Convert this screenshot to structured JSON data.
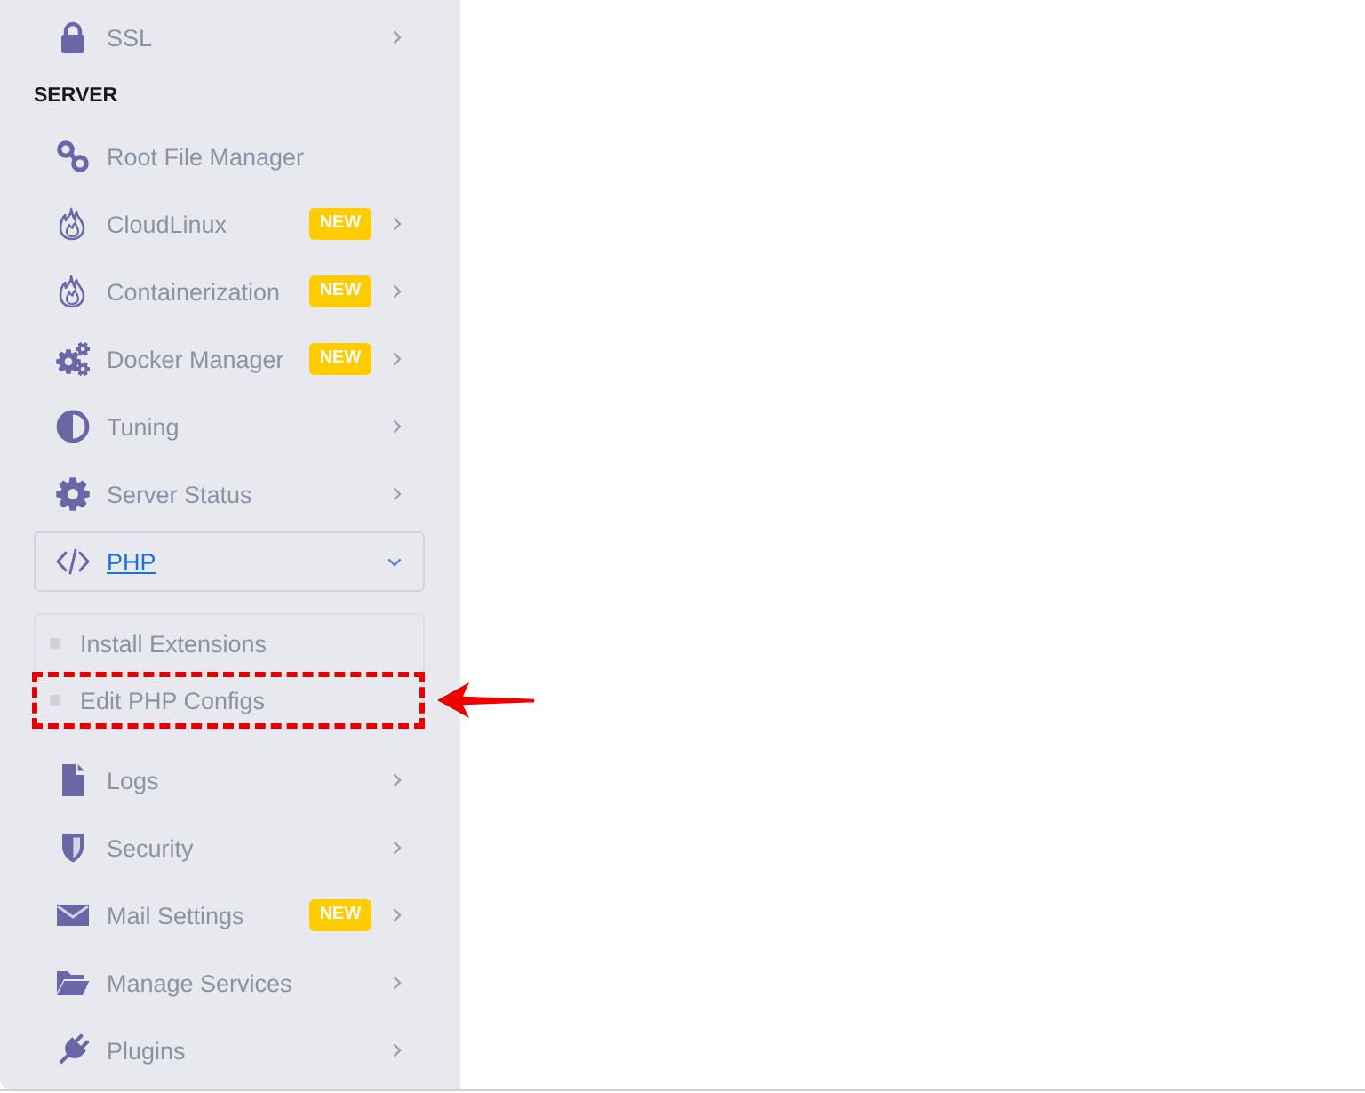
{
  "sidebar": {
    "items": [
      {
        "kind": "menu",
        "label": "SSL",
        "selected": false,
        "expanded": false
      },
      {
        "kind": "header",
        "label": "SERVER"
      },
      {
        "kind": "link",
        "label": "Root File Manager",
        "selected": false
      },
      {
        "kind": "menu",
        "label": "CloudLinux",
        "badge": "NEW",
        "selected": false,
        "expanded": false
      },
      {
        "kind": "menu",
        "label": "Containerization",
        "badge": "NEW",
        "selected": false,
        "expanded": false
      },
      {
        "kind": "menu",
        "label": "Docker Manager",
        "badge": "NEW",
        "selected": false,
        "expanded": false
      },
      {
        "kind": "menu",
        "label": "Tuning",
        "selected": false,
        "expanded": false
      },
      {
        "kind": "menu",
        "label": "Server Status",
        "selected": false,
        "expanded": false
      },
      {
        "kind": "menu",
        "label": "PHP",
        "selected": true,
        "expanded": true,
        "children": [
          {
            "label": "Install Extensions",
            "selected": false,
            "callout": false
          },
          {
            "label": "Edit PHP Configs",
            "selected": false,
            "callout": true
          }
        ]
      },
      {
        "kind": "menu",
        "label": "Logs",
        "selected": false,
        "expanded": false
      },
      {
        "kind": "menu",
        "label": "Security",
        "selected": false,
        "expanded": false
      },
      {
        "kind": "menu",
        "label": "Mail Settings",
        "badge": "NEW",
        "selected": false,
        "expanded": false
      },
      {
        "kind": "menu",
        "label": "Manage Services",
        "selected": false,
        "expanded": false
      },
      {
        "kind": "menu",
        "label": "Plugins",
        "selected": false,
        "expanded": false
      }
    ]
  }
}
